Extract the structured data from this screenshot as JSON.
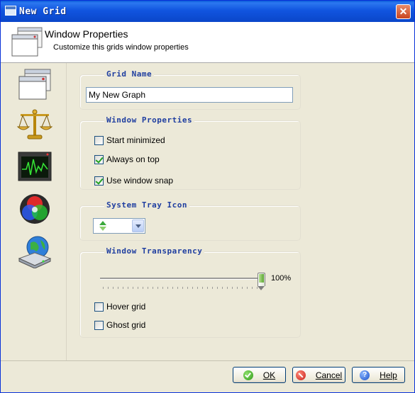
{
  "window": {
    "title": "New Grid"
  },
  "header": {
    "title": "Window Properties",
    "subtitle": "Customize this grids window properties"
  },
  "sidebar": {
    "items": [
      {
        "icon": "window-properties-icon"
      },
      {
        "icon": "scales-icon"
      },
      {
        "icon": "monitor-graph-icon"
      },
      {
        "icon": "color-wheel-icon"
      },
      {
        "icon": "globe-drive-icon"
      }
    ]
  },
  "grid_name": {
    "section_title": "Grid Name",
    "value": "My New Graph"
  },
  "window_properties": {
    "section_title": "Window Properties",
    "start_minimized": {
      "label": "Start minimized",
      "checked": false
    },
    "always_on_top": {
      "label": "Always on top",
      "checked": true
    },
    "use_window_snap": {
      "label": "Use window snap",
      "checked": true
    }
  },
  "system_tray": {
    "section_title": "System Tray Icon",
    "selected_icon": "up-down-arrows-icon"
  },
  "transparency": {
    "section_title": "Window Transparency",
    "value_percent": 100,
    "value_label": "100%",
    "hover_grid": {
      "label": "Hover grid",
      "checked": false
    },
    "ghost_grid": {
      "label": "Ghost grid",
      "checked": false
    }
  },
  "footer": {
    "ok_label": "OK",
    "cancel_label": "Cancel",
    "help_label": "Help"
  }
}
